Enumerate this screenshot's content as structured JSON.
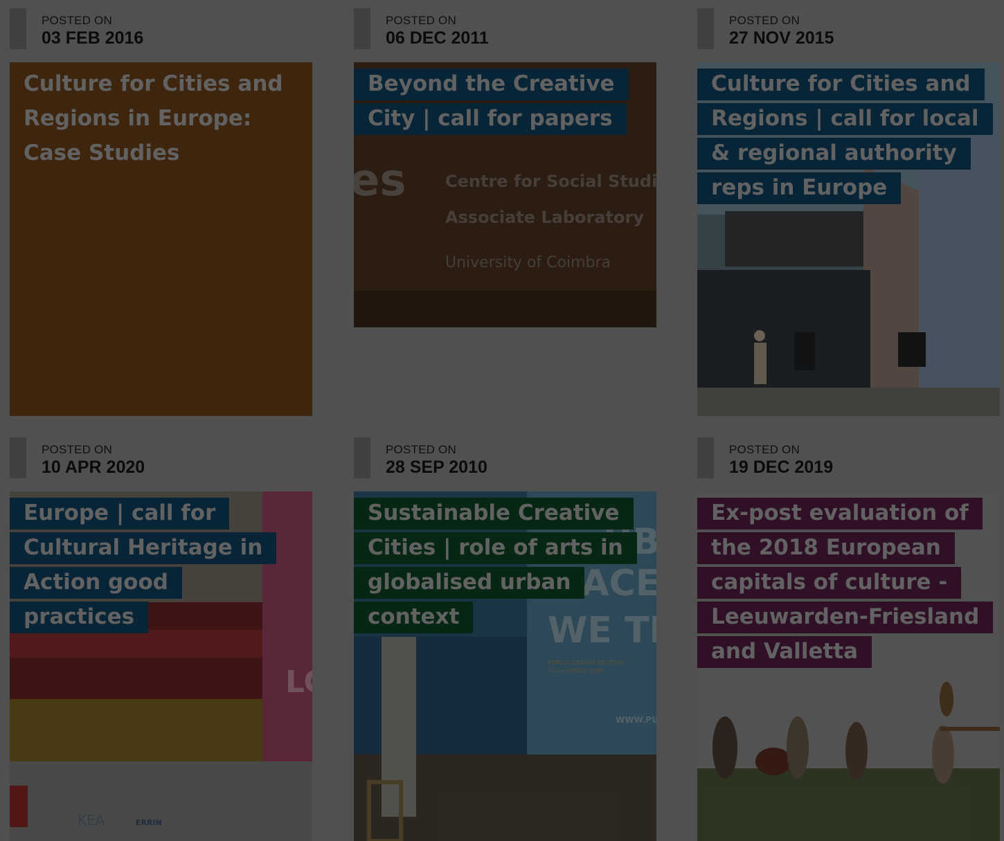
{
  "posts": [
    {
      "posted_label": "POSTED ON",
      "date": "03 FEB 2016",
      "title": "Culture for Cities and Regions in Europe: Case Studies",
      "highlight": "#6b4119",
      "image_icon": "orange-panel-image"
    },
    {
      "posted_label": "POSTED ON",
      "date": "06 DEC 2011",
      "title": "Beyond the Creative City | call for papers",
      "highlight": "#0f3f5f",
      "image_icon": "centre-social-studies-logo-image",
      "image_text": [
        "es",
        "Centre for Social Studies",
        "Associate Laboratory",
        "University of Coimbra"
      ]
    },
    {
      "posted_label": "POSTED ON",
      "date": "27 NOV 2015",
      "title": "Culture for Cities and Regions | call for local & regional authority reps in Europe",
      "highlight": "#0f3f5f",
      "image_icon": "street-concert-photo"
    },
    {
      "posted_label": "POSTED ON",
      "date": "10 APR 2020",
      "title": "Europe | call for Cultural Heritage in Action good practices",
      "highlight": "#0f3f5f",
      "image_icon": "opera-house-brochure-image",
      "image_text": [
        "LO",
        "KEA",
        "ERRIN"
      ]
    },
    {
      "posted_label": "POSTED ON",
      "date": "28 SEP 2010",
      "title": "Sustainable Creative Cities | role of arts in globalised urban context",
      "highlight": "#0d4424",
      "image_icon": "public-space-poster-photo",
      "image_text": [
        "UBL",
        "PACE",
        "WE TRU",
        "PUBLIC DESIGN FESTIVAL",
        "15-26 APRILE 2009",
        "WWW.PUB"
      ]
    },
    {
      "posted_label": "POSTED ON",
      "date": "19 DEC 2019",
      "title": "Ex-post evaluation of the 2018 European capitals of culture - Leeuwarden-Friesland and Valletta",
      "highlight": "#521c44",
      "image_icon": "musicians-field-photo"
    }
  ]
}
